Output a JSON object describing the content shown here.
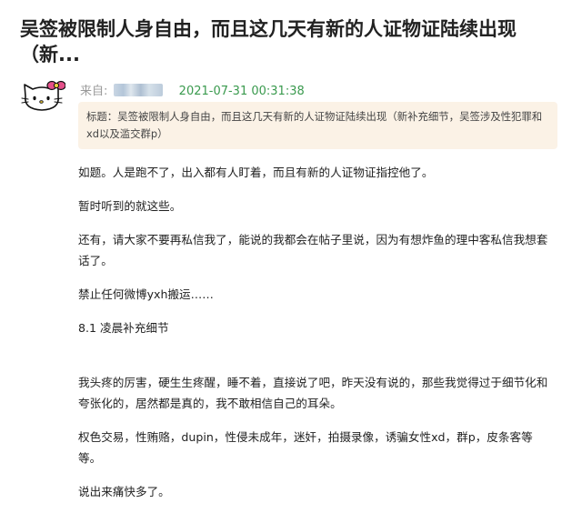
{
  "post": {
    "title": "吴签被限制人身自由，而且这几天有新的人证物证陆续出现（新...",
    "from_label": "来自:",
    "timestamp": "2021-07-31 00:31:38",
    "quote": "标题：吴签被限制人身自由，而且这几天有新的人证物证陆续出现（新补充细节，吴签涉及性犯罪和xd以及滥交群p）",
    "paragraphs": [
      "如题。人是跑不了，出入都有人盯着，而且有新的人证物证指控他了。",
      "暂时听到的就这些。",
      "还有，请大家不要再私信我了，能说的我都会在帖子里说，因为有想炸鱼的理中客私信我想套话了。",
      "禁止任何微博yxh搬运……",
      "8.1 凌晨补充细节",
      "我头疼的厉害，硬生生疼醒，睡不着，直接说了吧，昨天没有说的，那些我觉得过于细节化和夸张化的，居然都是真的，我不敢相信自己的耳朵。",
      "权色交易，性贿赂，dupin，性侵未成年，迷奸，拍摄录像，诱骗女性xd，群p，皮条客等等。",
      "说出来痛快多了。"
    ]
  },
  "avatar_icon": "hello-kitty-avatar-icon",
  "colors": {
    "date": "#3a9a4e",
    "quote_bg": "#fbf2e6",
    "bow": "#e4508a"
  }
}
